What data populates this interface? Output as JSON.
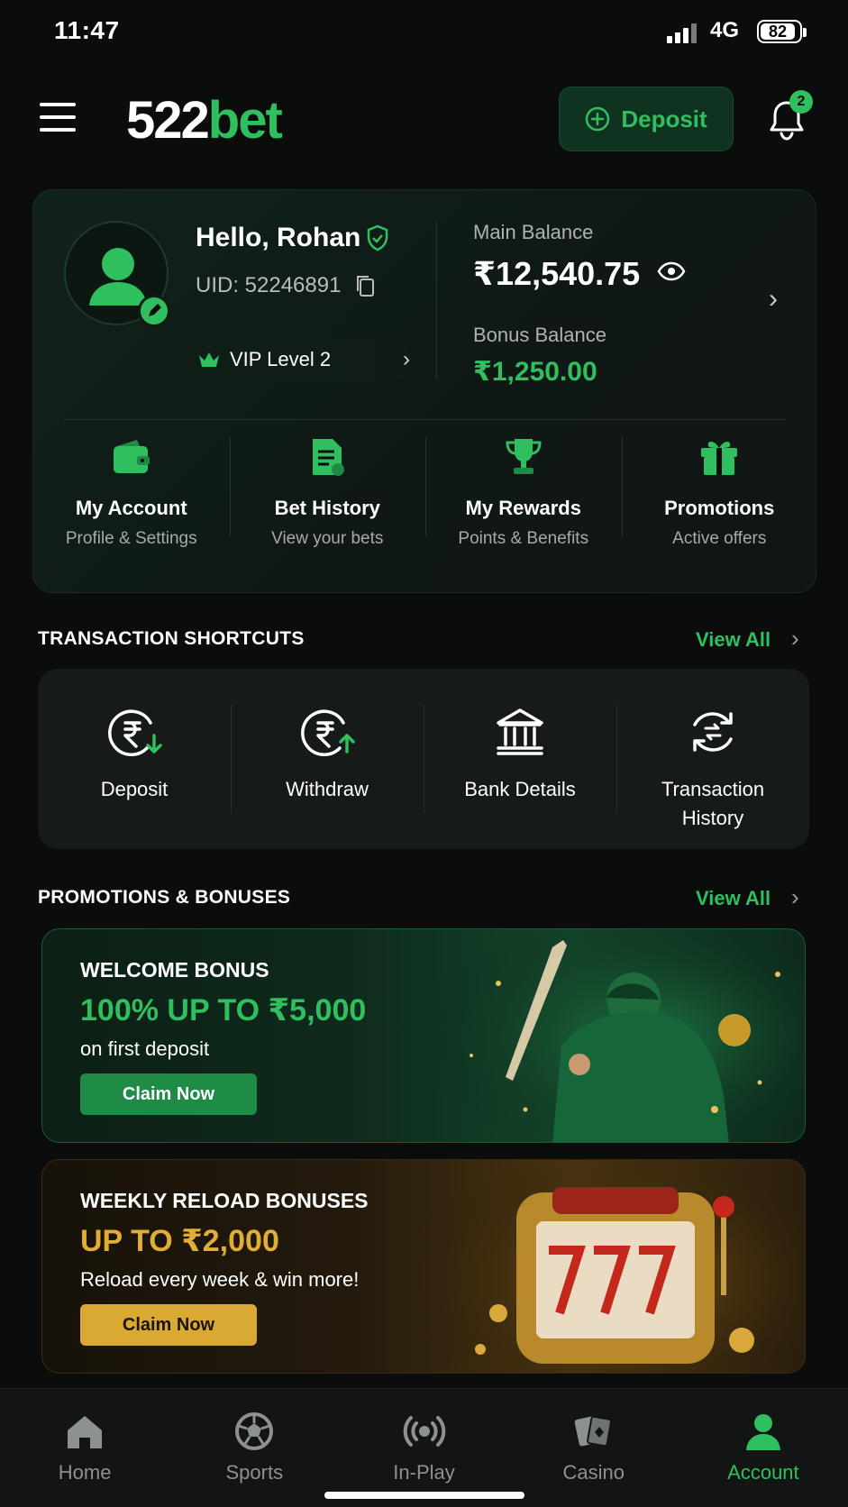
{
  "status_bar": {
    "time": "11:47",
    "network": "4G",
    "battery": "82"
  },
  "header": {
    "brand_num": "522",
    "brand_word": "bet",
    "deposit_label": "Deposit",
    "notification_count": "2"
  },
  "profile": {
    "greeting": "Hello, Rohan",
    "uid": "UID: 52246891",
    "vip_label": "VIP Level 2",
    "main_balance_label": "Main Balance",
    "main_balance": "₹12,540.75",
    "bonus_balance_label": "Bonus Balance",
    "bonus_balance": "₹1,250.00"
  },
  "quick_links": [
    {
      "title": "My Account",
      "subtitle": "Profile & Settings",
      "icon": "wallet-icon"
    },
    {
      "title": "Bet History",
      "subtitle": "View your bets",
      "icon": "document-icon"
    },
    {
      "title": "My Rewards",
      "subtitle": "Points & Benefits",
      "icon": "trophy-icon"
    },
    {
      "title": "Promotions",
      "subtitle": "Active offers",
      "icon": "gift-icon"
    }
  ],
  "transactions": {
    "heading": "TRANSACTION SHORTCUTS",
    "view_all": "View All",
    "items": [
      {
        "label": "Deposit",
        "icon": "rupee-deposit-icon"
      },
      {
        "label": "Withdraw",
        "icon": "rupee-withdraw-icon"
      },
      {
        "label": "Bank Details",
        "icon": "bank-icon"
      },
      {
        "label": "Transaction History",
        "icon": "history-icon"
      }
    ]
  },
  "promotions": {
    "heading": "PROMOTIONS & BONUSES",
    "view_all": "View All",
    "banners": [
      {
        "title": "WELCOME BONUS",
        "amount": "100% UP TO ₹5,000",
        "subtitle": "on first deposit",
        "cta": "Claim Now",
        "accent": "#2fbf5f"
      },
      {
        "title": "WEEKLY RELOAD BONUSES",
        "amount": "UP TO ₹2,000",
        "subtitle": "Reload every week & win more!",
        "cta": "Claim Now",
        "accent": "#e0ad35"
      }
    ]
  },
  "bottom_nav": [
    {
      "label": "Home",
      "icon": "home-icon",
      "active": false
    },
    {
      "label": "Sports",
      "icon": "ball-icon",
      "active": false
    },
    {
      "label": "In-Play",
      "icon": "broadcast-icon",
      "active": false
    },
    {
      "label": "Casino",
      "icon": "cards-icon",
      "active": false
    },
    {
      "label": "Account",
      "icon": "user-icon",
      "active": true
    }
  ],
  "colors": {
    "accent": "#2fbf5f",
    "gold": "#e0ad35",
    "background": "#0b0d0c"
  }
}
